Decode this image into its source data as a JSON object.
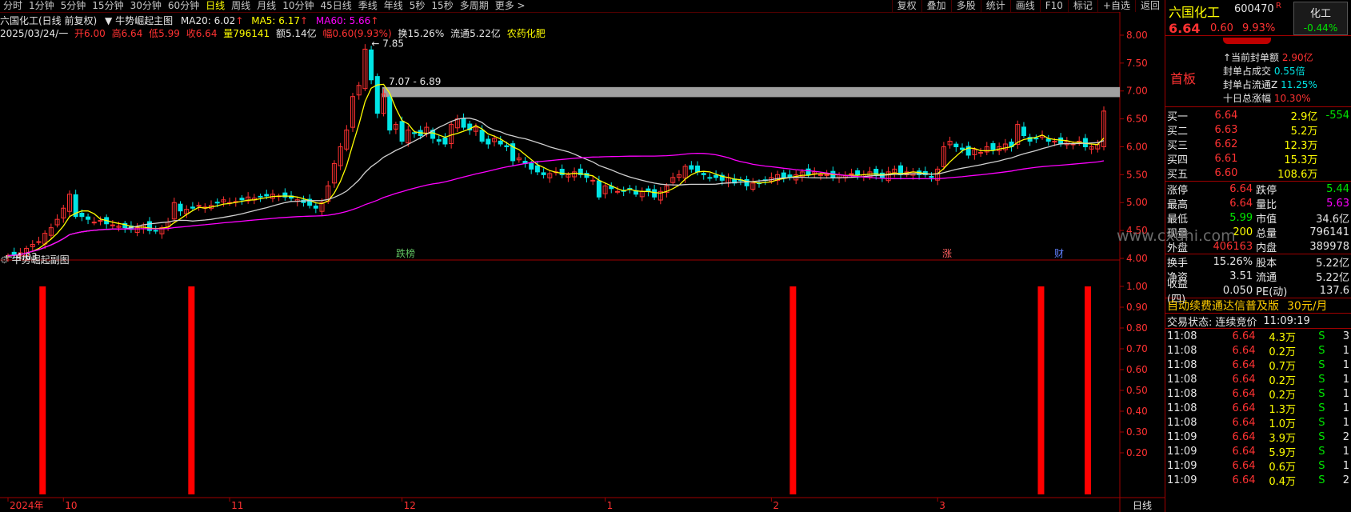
{
  "toolbar": {
    "items": [
      "分时",
      "1分钟",
      "5分钟",
      "15分钟",
      "30分钟",
      "60分钟",
      "日线",
      "周线",
      "月线",
      "10分钟",
      "45日线",
      "季线",
      "年线",
      "5秒",
      "15秒",
      "多周期",
      "更多 >"
    ],
    "active": "日线",
    "right_items": [
      "复权",
      "叠加",
      "多股",
      "统计",
      "画线",
      "F10",
      "标记",
      "+自选",
      "返回"
    ]
  },
  "header": {
    "title": "六国化工(日线 前复权)",
    "indicator": "牛势崛起主图",
    "ma20": "MA20: 6.02",
    "ma5": "MA5: 6.17",
    "ma60": "MA60: 5.66",
    "date": "2025/03/24/一",
    "open": "开6.00",
    "high": "高6.64",
    "low": "低5.99",
    "close": "收6.64",
    "vol": "量796141",
    "amount": "额5.14亿",
    "change": "幅0.60(9.93%)",
    "turnover": "换15.26%",
    "float": "流通5.22亿",
    "sector": "农药化肥"
  },
  "colors": {
    "up": "#ff3232",
    "down": "#00e5e5",
    "ma5": "#ffff00",
    "ma20": "#d0d0d0",
    "ma60": "#ff00ff",
    "grid": "#a00000",
    "band": "#a0a0a0",
    "bars": "#ff0000"
  },
  "chart_data": [
    {
      "type": "candlestick",
      "title": "牛势崛起主图",
      "ylim": [
        4.0,
        8.1
      ],
      "yticks": [
        "8.00",
        "7.50",
        "7.00",
        "6.50",
        "6.00",
        "5.50",
        "5.00",
        "4.50",
        "4.00"
      ],
      "yticks_values": [
        8.0,
        7.5,
        7.0,
        6.5,
        6.0,
        5.5,
        5.0,
        4.5,
        4.0
      ],
      "annotations": {
        "high": "7.85",
        "low": "4.03",
        "band": "7.07 - 6.89"
      },
      "markers": [
        "跌榜",
        "涨",
        "财"
      ],
      "close_series": [
        4.05,
        4.06,
        4.1,
        4.18,
        4.25,
        4.3,
        4.45,
        4.55,
        4.7,
        4.9,
        5.15,
        4.75,
        4.75,
        4.7,
        4.65,
        4.68,
        4.62,
        4.6,
        4.58,
        4.55,
        4.52,
        4.55,
        4.6,
        4.5,
        4.5,
        4.55,
        4.65,
        5.0,
        4.85,
        4.88,
        4.9,
        4.95,
        4.92,
        4.95,
        5.0,
        5.05,
        5.0,
        5.02,
        5.05,
        5.1,
        5.08,
        5.1,
        5.12,
        5.15,
        5.12,
        5.1,
        5.08,
        5.05,
        5.0,
        4.95,
        4.9,
        5.0,
        5.3,
        5.7,
        6.0,
        6.3,
        6.9,
        7.1,
        7.75,
        7.2,
        6.6,
        6.95,
        6.3,
        6.4,
        6.1,
        6.3,
        6.25,
        6.2,
        6.35,
        6.15,
        6.1,
        6.05,
        6.4,
        6.5,
        6.35,
        6.3,
        6.35,
        6.1,
        6.05,
        6.15,
        6.05,
        6.0,
        5.75,
        5.8,
        5.7,
        5.6,
        5.55,
        5.5,
        5.52,
        5.55,
        5.5,
        5.5,
        5.55,
        5.5,
        5.45,
        5.4,
        5.1,
        5.3,
        5.25,
        5.2,
        5.2,
        5.25,
        5.15,
        5.2,
        5.2,
        5.1,
        5.2,
        5.3,
        5.45,
        5.5,
        5.65,
        5.6,
        5.55,
        5.5,
        5.45,
        5.45,
        5.4,
        5.45,
        5.35,
        5.4,
        5.3,
        5.35,
        5.35,
        5.4,
        5.45,
        5.5,
        5.45,
        5.45,
        5.5,
        5.55,
        5.5,
        5.55,
        5.5,
        5.5,
        5.45,
        5.5,
        5.48,
        5.52,
        5.5,
        5.5,
        5.55,
        5.5,
        5.45,
        5.55,
        5.6,
        5.5,
        5.55,
        5.55,
        5.5,
        5.5,
        5.45,
        5.6,
        6.0,
        6.1,
        6.0,
        5.95,
        5.85,
        5.95,
        5.9,
        6.0,
        5.95,
        6.0,
        6.05,
        6.0,
        6.4,
        6.2,
        6.1,
        6.15,
        6.2,
        6.1,
        6.1,
        6.05,
        6.1,
        6.05,
        6.1,
        6.0,
        6.0,
        6.04,
        6.64
      ]
    },
    {
      "type": "bar",
      "title": "牛势崛起副图",
      "ylim": [
        0,
        1.05
      ],
      "yticks": [
        "1.00",
        "0.90",
        "0.80",
        "0.70",
        "0.60",
        "0.50",
        "0.40",
        "0.30",
        "0.20"
      ],
      "yticks_values": [
        1.0,
        0.9,
        0.8,
        0.7,
        0.6,
        0.5,
        0.4,
        0.3,
        0.2
      ],
      "signal_index": [
        3,
        27,
        124,
        164,
        184
      ],
      "values": [
        1,
        1,
        1,
        1,
        1
      ],
      "x_labels": [
        "2024年",
        "10",
        "11",
        "12",
        "1",
        "2",
        "3"
      ],
      "x_label_index": [
        0,
        9,
        36,
        64,
        97,
        124,
        151
      ],
      "period_label": "日线"
    }
  ],
  "side": {
    "name": "六国化工",
    "code": "600470",
    "r": "R",
    "sector": "化工",
    "sector_change": "-0.44%",
    "price": "6.64",
    "change": "0.60",
    "pct": "9.93%",
    "board": "首板",
    "seal_rows": [
      {
        "label": "当前封单额",
        "value": "2.90亿"
      },
      {
        "label": "封单占成交",
        "value": "0.55倍"
      },
      {
        "label": "封单占流通Z",
        "value": "11.25%"
      },
      {
        "label": "十日总涨幅",
        "value": "10.30%"
      }
    ],
    "buys": [
      {
        "label": "买一",
        "price": "6.64",
        "vol": "2.9亿",
        "extra": "-554"
      },
      {
        "label": "买二",
        "price": "6.63",
        "vol": "5.2万",
        "extra": ""
      },
      {
        "label": "买三",
        "price": "6.62",
        "vol": "12.3万",
        "extra": ""
      },
      {
        "label": "买四",
        "price": "6.61",
        "vol": "15.3万",
        "extra": ""
      },
      {
        "label": "买五",
        "price": "6.60",
        "vol": "108.6万",
        "extra": ""
      }
    ],
    "stats": [
      {
        "l1": "涨停",
        "v1": "6.64",
        "l2": "跌停",
        "v2": "5.44"
      },
      {
        "l1": "最高",
        "v1": "6.64",
        "l2": "量比",
        "v2": "5.63"
      },
      {
        "l1": "最低",
        "v1": "5.99",
        "l2": "市值",
        "v2": "34.6亿"
      },
      {
        "l1": "现量",
        "v1": "200",
        "l2": "总量",
        "v2": "796141"
      },
      {
        "l1": "外盘",
        "v1": "406163",
        "l2": "内盘",
        "v2": "389978"
      }
    ],
    "fin": [
      {
        "l1": "换手",
        "v1": "15.26%",
        "l2": "股本",
        "v2": "5.22亿"
      },
      {
        "l1": "净资",
        "v1": "3.51",
        "l2": "流通",
        "v2": "5.22亿"
      },
      {
        "l1": "收益(四)",
        "v1": "0.050",
        "l2": "PE(动)",
        "v2": "137.6"
      }
    ],
    "ad_text": "自动续费通达信普及版",
    "ad_price": "30元/月",
    "status_label": "交易状态:",
    "status_value": "连续竞价",
    "status_time": "11:09:19",
    "ticks": [
      {
        "t": "11:08",
        "p": "6.64",
        "v": "4.3万",
        "s": "S",
        "n": "3"
      },
      {
        "t": "11:08",
        "p": "6.64",
        "v": "0.2万",
        "s": "S",
        "n": "1"
      },
      {
        "t": "11:08",
        "p": "6.64",
        "v": "0.7万",
        "s": "S",
        "n": "1"
      },
      {
        "t": "11:08",
        "p": "6.64",
        "v": "0.2万",
        "s": "S",
        "n": "1"
      },
      {
        "t": "11:08",
        "p": "6.64",
        "v": "0.2万",
        "s": "S",
        "n": "1"
      },
      {
        "t": "11:08",
        "p": "6.64",
        "v": "1.3万",
        "s": "S",
        "n": "1"
      },
      {
        "t": "11:08",
        "p": "6.64",
        "v": "1.0万",
        "s": "S",
        "n": "1"
      },
      {
        "t": "11:09",
        "p": "6.64",
        "v": "3.9万",
        "s": "S",
        "n": "2"
      },
      {
        "t": "11:09",
        "p": "6.64",
        "v": "5.9万",
        "s": "S",
        "n": "1"
      },
      {
        "t": "11:09",
        "p": "6.64",
        "v": "0.6万",
        "s": "S",
        "n": "1"
      },
      {
        "t": "11:09",
        "p": "6.64",
        "v": "0.4万",
        "s": "S",
        "n": "2"
      }
    ],
    "watermark": "www.cxdhi.com"
  }
}
